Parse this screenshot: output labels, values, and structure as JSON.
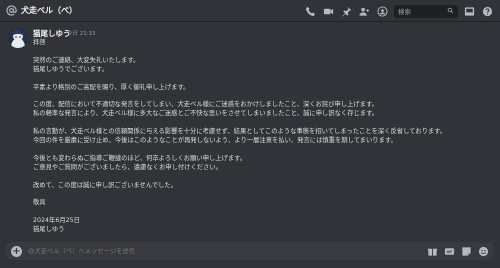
{
  "header": {
    "channel_name": "犬走ベル（べ）",
    "search_placeholder": "検索",
    "icons": [
      "at-sign-icon",
      "phone-icon",
      "video-icon",
      "thread-icon",
      "pin-icon",
      "add-member-icon",
      "user-icon",
      "inbox-icon",
      "help-icon"
    ]
  },
  "message": {
    "author": "猫尾しゆう",
    "timestamp": "今日 21:33",
    "lines": [
      "拝啓",
      "",
      "突然のご連絡、大変失礼いたします。",
      "猫尾しゆうでございます。",
      "",
      "平素より格別のご高配を賜り、厚く御礼申し上げます。",
      "",
      "この度、配信において不適切な発言をしてしまい、犬走ベル様にご迷惑をおかけしましたこと、深くお詫び申し上げます。",
      "私の軽率な発言により、犬走ベル様に多大なご迷惑とご不快な思いをさせてしまいましたこと、誠に申し訳なく存じます。",
      "",
      "私の言動が、犬走ベル様との信頼関係に与える影響を十分に考慮せず、結果としてこのような事態を招いてしまったことを深く反省しております。",
      "今回の件を厳粛に受け止め、今後はこのようなことが再発しないよう、より一層注意を払い、発言には慎重を期してまいります。",
      "",
      "今後とも変わらぬご指導ご鞭撻のほど、何卒よろしくお願い申し上げます。",
      "ご意見やご質問がございましたら、遠慮なくお申し付けください。",
      "",
      "改めて、この度は誠に申し訳ございませんでした。",
      "",
      "敬具",
      "",
      "2024年6月25日",
      "猫尾しゆう"
    ]
  },
  "composer": {
    "placeholder": "@犬走ベル（べ）へメッセージを送信",
    "icons": [
      "plus-icon",
      "gift-icon",
      "gif-icon",
      "sticker-icon",
      "emoji-icon"
    ]
  },
  "colors": {
    "background": "#313338",
    "composer": "#383a40",
    "text": "#dbdee1",
    "muted": "#949ba4"
  }
}
